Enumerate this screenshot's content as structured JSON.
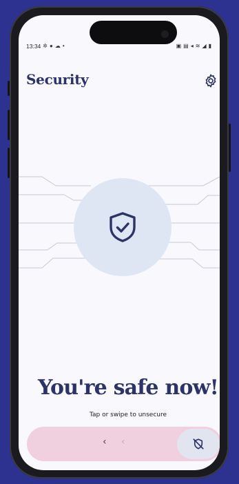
{
  "status_bar": {
    "time": "13:34",
    "left_icons": [
      "notification-icon",
      "message-icon",
      "cloud-icon",
      "dot-icon"
    ],
    "right_icons": [
      "nfc-icon",
      "cast-icon",
      "mute-icon",
      "wifi-icon",
      "signal-icon",
      "battery-icon"
    ]
  },
  "header": {
    "title": "Security",
    "settings_icon": "gear-icon"
  },
  "status_visual": {
    "icon": "shield-check-icon",
    "circle_color": "#dfe6f3",
    "accent_color": "#2b3367"
  },
  "main": {
    "headline": "You're safe now!",
    "hint": "Tap or swipe to unsecure"
  },
  "slider": {
    "chevrons": [
      "‹",
      "‹"
    ],
    "knob_icon": "shield-off-icon",
    "track_color": "#f0cfdf"
  }
}
